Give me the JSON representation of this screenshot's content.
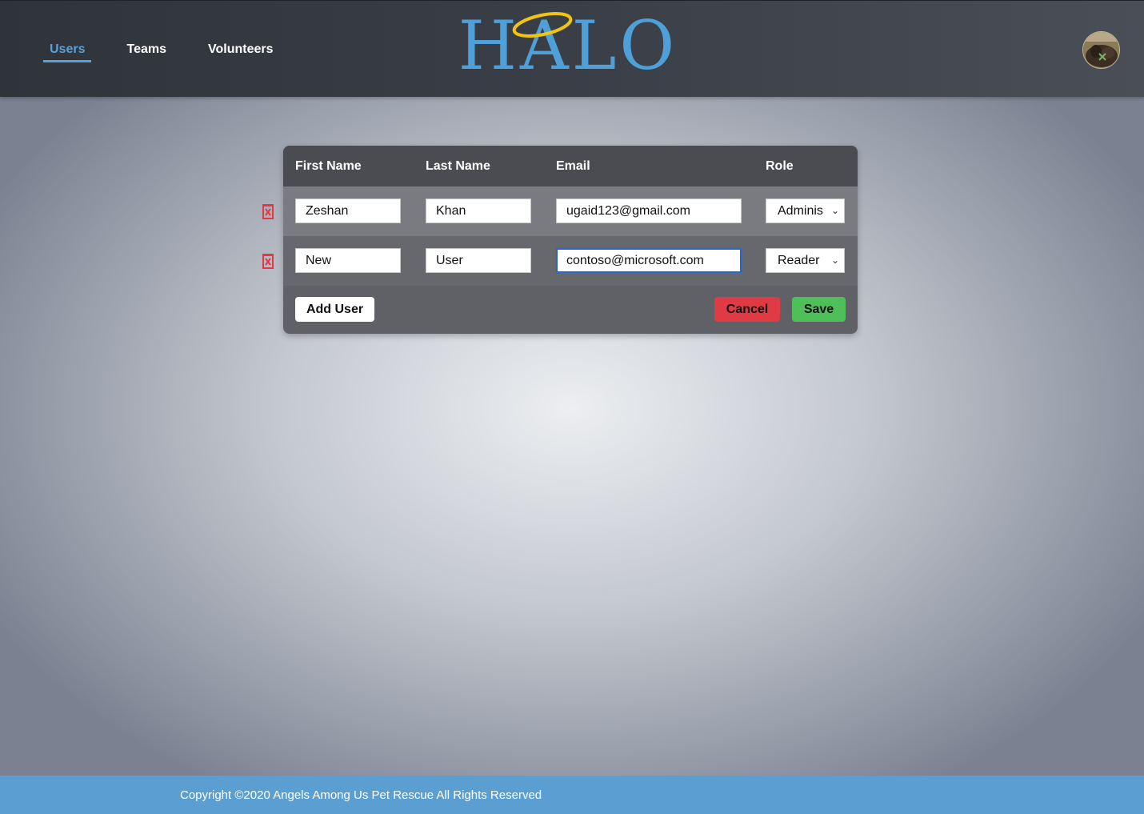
{
  "nav": {
    "items": [
      {
        "label": "Users",
        "active": true
      },
      {
        "label": "Teams",
        "active": false
      },
      {
        "label": "Volunteers",
        "active": false
      }
    ]
  },
  "logo": {
    "text": "HALO",
    "color": "#4f9fd8",
    "ring_color": "#f1c40f"
  },
  "avatar": {
    "icon": "user-avatar-photo"
  },
  "table": {
    "headers": {
      "first_name": "First Name",
      "last_name": "Last Name",
      "email": "Email",
      "role": "Role"
    },
    "rows": [
      {
        "first_name": "Zeshan",
        "last_name": "Khan",
        "email": "ugaid123@gmail.com",
        "role": "Adminis"
      },
      {
        "first_name": "New",
        "last_name": "User",
        "email": "contoso@microsoft.com",
        "role": "Reader"
      }
    ]
  },
  "actions": {
    "add_user": "Add User",
    "cancel": "Cancel",
    "save": "Save"
  },
  "colors": {
    "accent": "#5aa0d8",
    "cancel": "#e03a45",
    "save": "#4fbf5a",
    "delete_icon": "#e03a45"
  },
  "footer": {
    "text": "Copyright ©2020 Angels Among Us Pet Rescue All Rights Reserved"
  }
}
